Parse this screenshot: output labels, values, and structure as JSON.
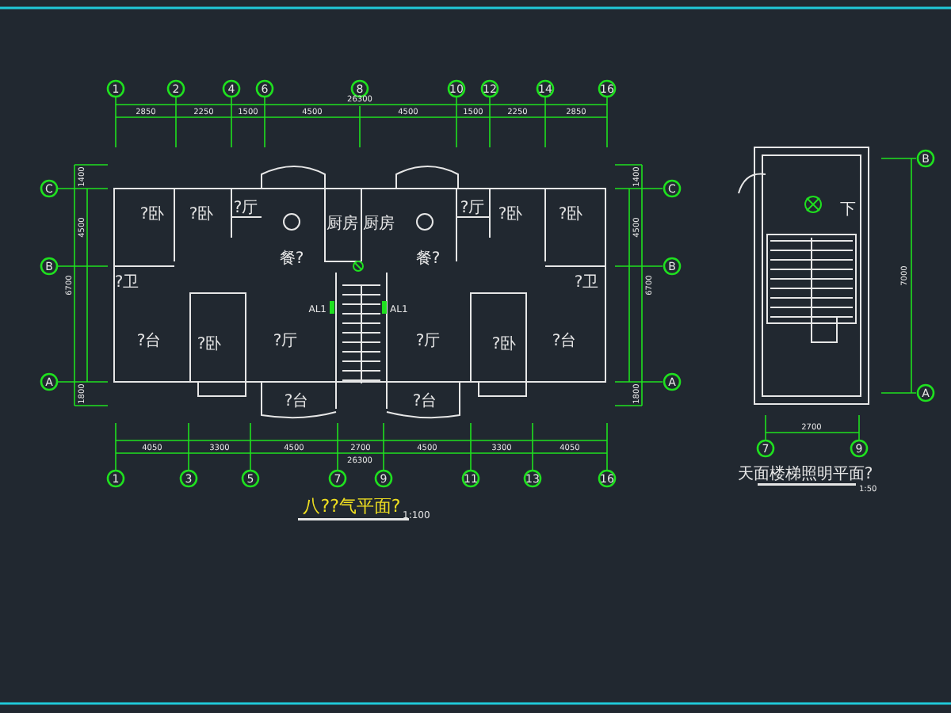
{
  "plan": {
    "title": "八??气平面?",
    "scale": "1:100",
    "top_axes": [
      "1",
      "2",
      "4",
      "6",
      "8",
      "10",
      "12",
      "14",
      "16"
    ],
    "top_total": "26300",
    "top_dims": [
      "2850",
      "2250",
      "1500",
      "4500",
      "4500",
      "1500",
      "2250",
      "2850"
    ],
    "bottom_axes": [
      "1",
      "3",
      "5",
      "7",
      "9",
      "11",
      "13",
      "16"
    ],
    "bottom_dims": [
      "4050",
      "3300",
      "4500",
      "2700",
      "4500",
      "3300",
      "4050"
    ],
    "bottom_total": "26300",
    "left_axes": [
      "C",
      "B",
      "A"
    ],
    "left_dims": [
      "1400",
      "4500",
      "6700",
      "1800"
    ],
    "right_axes": [
      "C",
      "B",
      "A"
    ],
    "right_dims": [
      "1400",
      "4500",
      "6700",
      "1800"
    ],
    "rooms": [
      "?卧",
      "?卧",
      "?厅",
      "餐?",
      "厨房",
      "厨房",
      "餐?",
      "?厅",
      "?卧",
      "?卧",
      "?卫",
      "?卫",
      "?台",
      "?卧",
      "?厅",
      "?厅",
      "?卧",
      "?台",
      "?台",
      "?台"
    ],
    "panels": [
      "AL1",
      "AL1"
    ]
  },
  "stair": {
    "title": "天面楼梯照明平面?",
    "scale": "1:50",
    "right_axes": [
      "B",
      "A"
    ],
    "bottom_axes": [
      "7",
      "9"
    ],
    "width_dim": "2700",
    "height_dim": "7000",
    "down_label": "下"
  }
}
